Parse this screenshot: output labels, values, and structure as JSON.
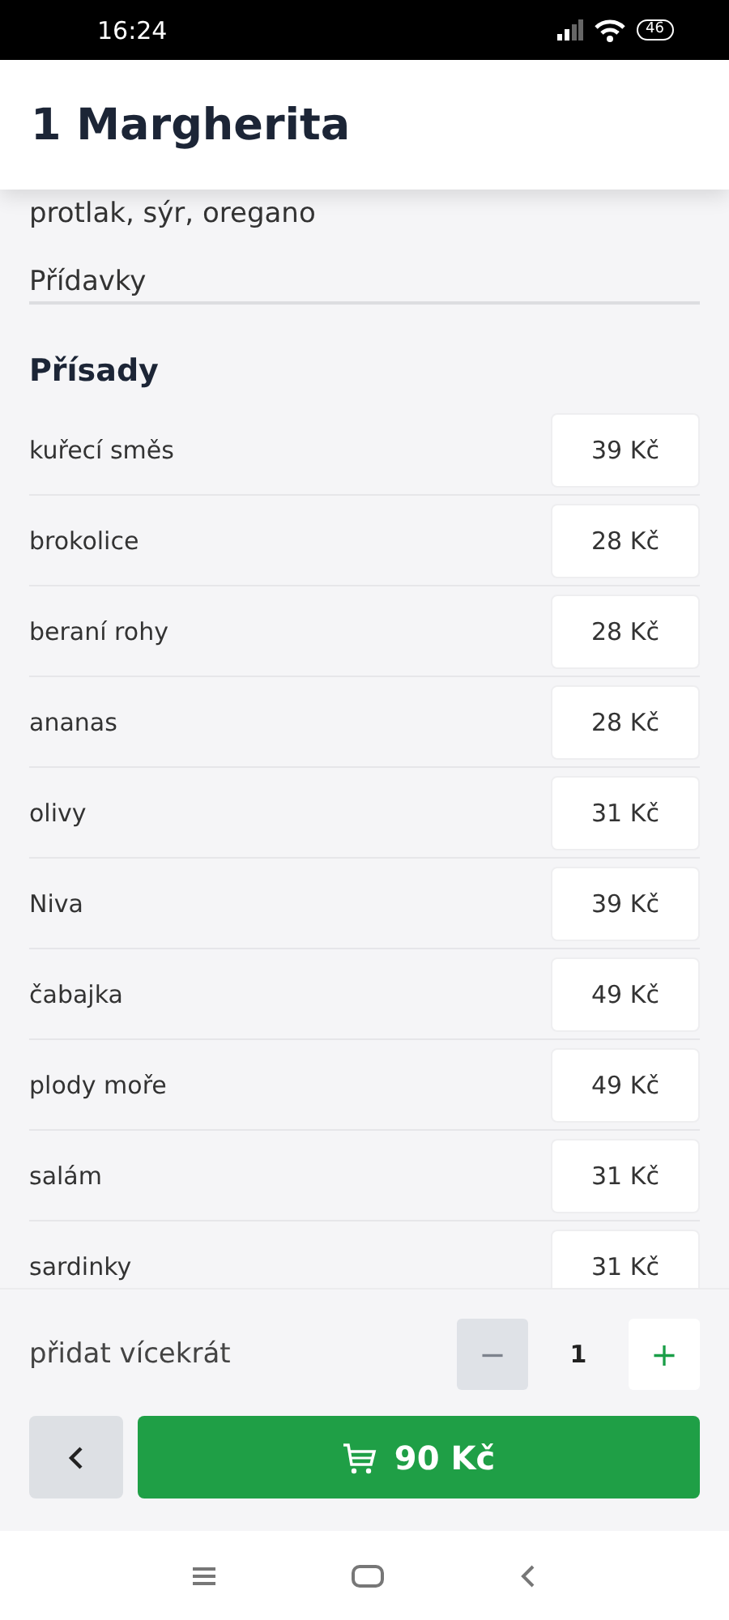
{
  "status_bar": {
    "time": "16:24",
    "battery": "46"
  },
  "header": {
    "title": "1 Margherita"
  },
  "description": "protlak, sýr, oregano",
  "tabs": [
    {
      "label": "Přídavky",
      "selected": true
    }
  ],
  "section_title": "Přísady",
  "ingredients": [
    {
      "name": "kuřecí směs",
      "price": "39 Kč"
    },
    {
      "name": "brokolice",
      "price": "28 Kč"
    },
    {
      "name": "beraní rohy",
      "price": "28 Kč"
    },
    {
      "name": "ananas",
      "price": "28 Kč"
    },
    {
      "name": "olivy",
      "price": "31 Kč"
    },
    {
      "name": "Niva",
      "price": "39 Kč"
    },
    {
      "name": "čabajka",
      "price": "49 Kč"
    },
    {
      "name": "plody moře",
      "price": "49 Kč"
    },
    {
      "name": "salám",
      "price": "31 Kč"
    },
    {
      "name": "sardinky",
      "price": "31 Kč"
    }
  ],
  "quantity": {
    "label": "přidat vícekrát",
    "minus": {
      "text": "−",
      "disabled": true
    },
    "value": "1",
    "plus": {
      "text": "+",
      "disabled": false
    }
  },
  "add_to_cart": {
    "price": "90 Kč"
  }
}
